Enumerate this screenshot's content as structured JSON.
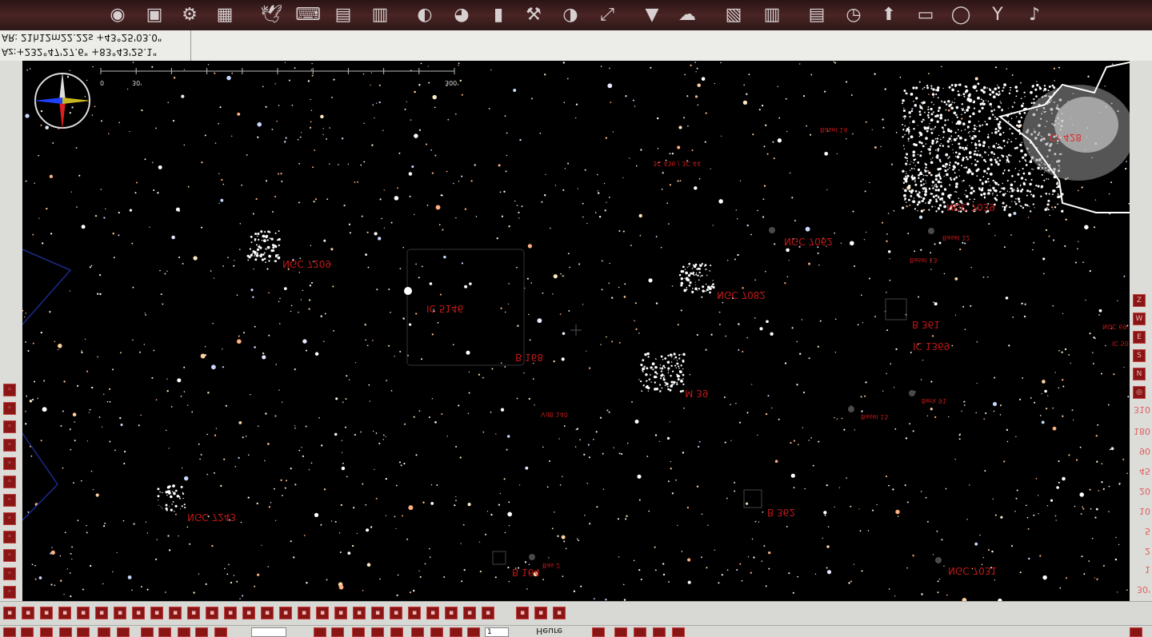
{
  "window": {
    "accent": "#8a1515",
    "label_color": "#c01818"
  },
  "toolbar": {
    "icons": [
      "ubuntu-icon",
      "terminal-icon",
      "settings-icon",
      "workspace-switcher-icon",
      "bird-icon",
      "keyboard-icon",
      "documents-icon",
      "photo-icon",
      "browser-icon",
      "firefox-icon",
      "film-icon",
      "tools-icon",
      "chart-icon",
      "maximize-icon",
      "download-icon",
      "clouds-icon",
      "scanner-icon",
      "cabinet-icon",
      "files-icon",
      "clock-icon",
      "upload-icon",
      "screen-icon",
      "power-icon",
      "user-icon",
      "volume-icon"
    ]
  },
  "coords": {
    "ra_line": "AR: 21h12m22.22s +43°25'03.0\"",
    "az_line": "Az:+232°47'27.6\" +83°43'25.1\""
  },
  "scale_bar": {
    "start": "0",
    "mid": "30'",
    "end": "300'"
  },
  "objects": [
    {
      "name": "NGC 7209",
      "kind": "cluster"
    },
    {
      "name": "IC 5146",
      "kind": "nebula"
    },
    {
      "name": "B 168",
      "kind": "dark"
    },
    {
      "name": "NGC 7082",
      "kind": "cluster"
    },
    {
      "name": "NGC 7062",
      "kind": "cluster"
    },
    {
      "name": "NGC 7039",
      "kind": "cluster"
    },
    {
      "name": "M 39",
      "kind": "cluster"
    },
    {
      "name": "B 361",
      "kind": "dark"
    },
    {
      "name": "IC 1369",
      "kind": "cluster"
    },
    {
      "name": "NGC 7243",
      "kind": "cluster"
    },
    {
      "name": "B 362",
      "kind": "dark"
    },
    {
      "name": "B 164",
      "kind": "dark"
    },
    {
      "name": "NGC 7031",
      "kind": "cluster"
    },
    {
      "name": "Cr 428",
      "kind": "cluster"
    },
    {
      "name": "3C 436 / 3C 44",
      "kind": "radio"
    },
    {
      "name": "Basel 14",
      "kind": "cluster"
    },
    {
      "name": "Basel 12",
      "kind": "cluster"
    },
    {
      "name": "Basel 13",
      "kind": "cluster"
    },
    {
      "name": "Basel 15",
      "kind": "cluster"
    },
    {
      "name": "Berk 91",
      "kind": "cluster"
    },
    {
      "name": "VdB 140",
      "kind": "nebula"
    },
    {
      "name": "Bas 2",
      "kind": "cluster"
    },
    {
      "name": "NGC 69",
      "kind": "cluster"
    },
    {
      "name": "IC 50",
      "kind": "cluster"
    }
  ],
  "right_panel": {
    "buttons": [
      "Z",
      "W",
      "E",
      "S",
      "N",
      "circle"
    ],
    "fov_values": [
      "310",
      "180",
      "90",
      "45",
      "20",
      "10",
      "5",
      "2",
      "1",
      "30'"
    ]
  },
  "bottom": {
    "heure_label": "Heure",
    "value": "1"
  }
}
